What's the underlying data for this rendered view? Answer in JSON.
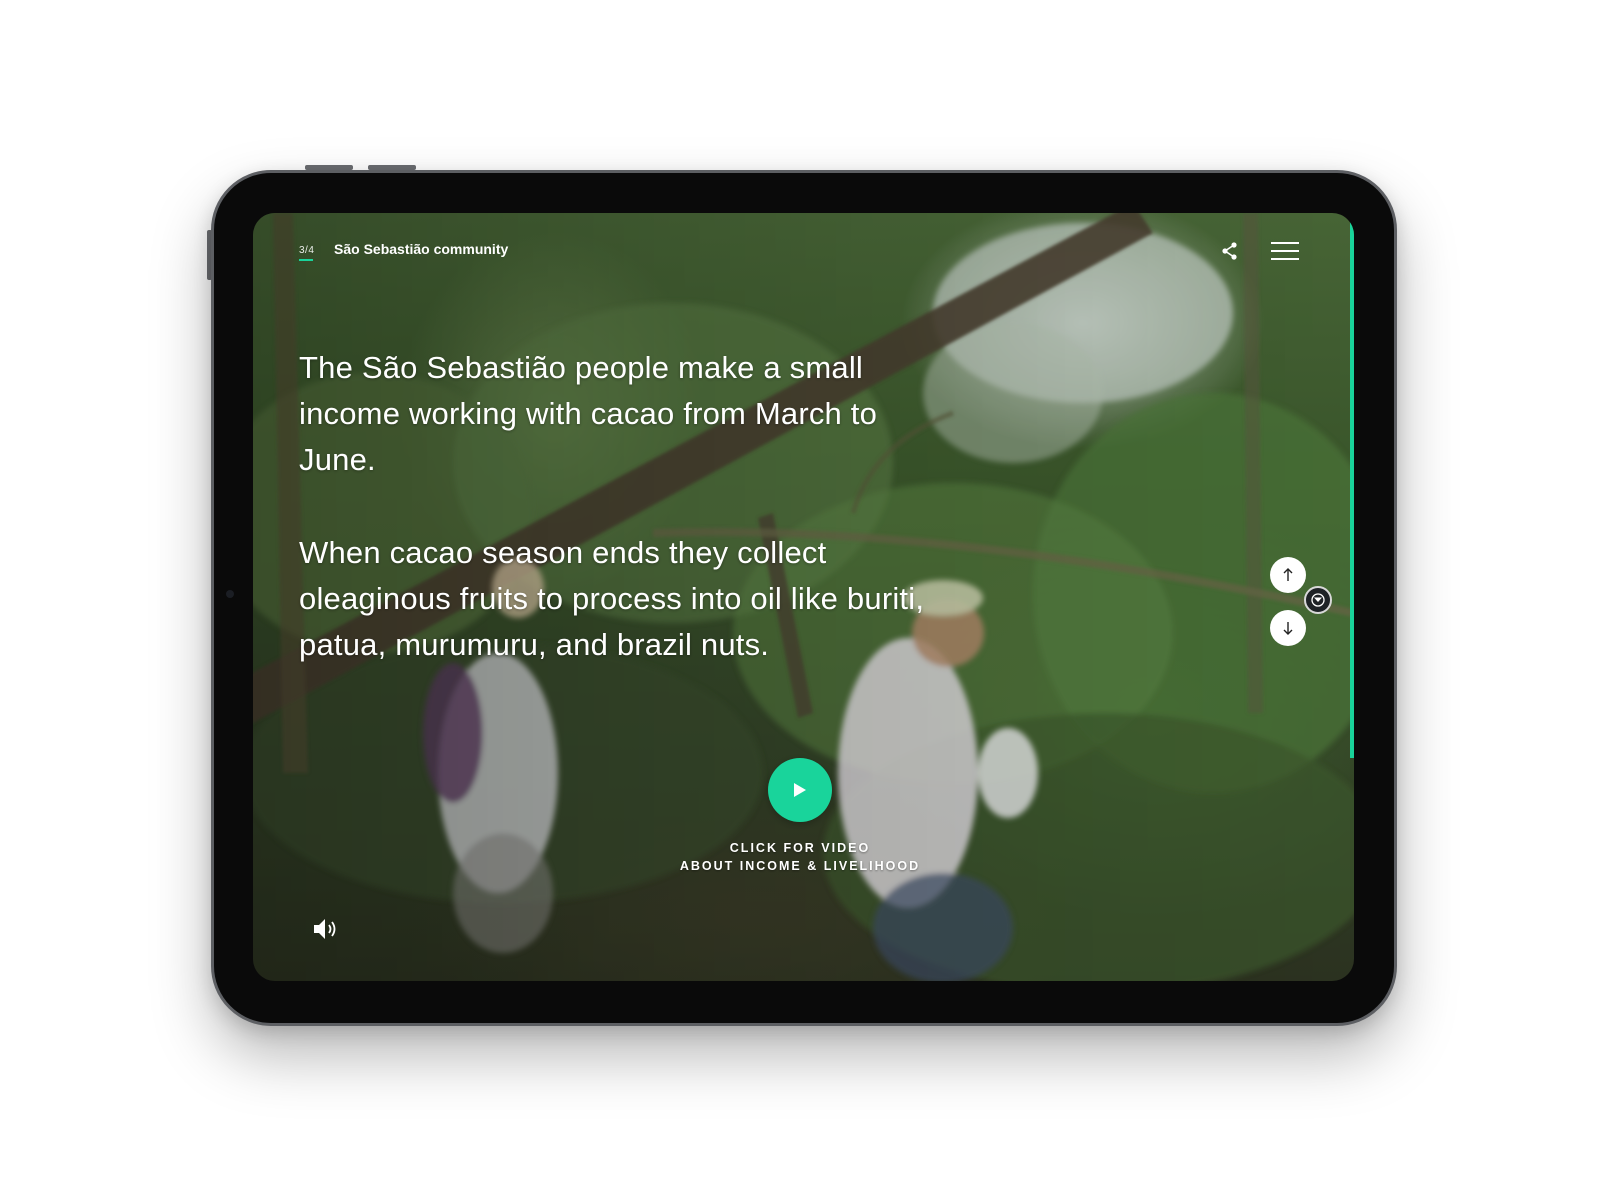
{
  "page": {
    "counter": "3/4",
    "section_title": "São Sebastião community"
  },
  "content": {
    "paragraph_1": "The São Sebastião people make a small income working with cacao from March to June.",
    "paragraph_2": "When cacao season ends they collect oleaginous fruits to process into oil like buriti, patua, murumuru, and brazil nuts."
  },
  "video_cta": {
    "line_1": "CLICK FOR VIDEO",
    "line_2": "ABOUT INCOME & LIVELIHOOD"
  },
  "icons": {
    "share": "share-icon",
    "menu": "hamburger-menu-icon",
    "prev": "arrow-up-icon",
    "next": "arrow-down-icon",
    "vr": "vr-view-icon",
    "play": "play-icon",
    "sound": "speaker-icon"
  },
  "colors": {
    "accent": "#19d49b",
    "text": "#ffffff",
    "device_frame": "#0a0a0a",
    "page_background": "#ffffff"
  },
  "progress": {
    "fraction": 0.71
  }
}
